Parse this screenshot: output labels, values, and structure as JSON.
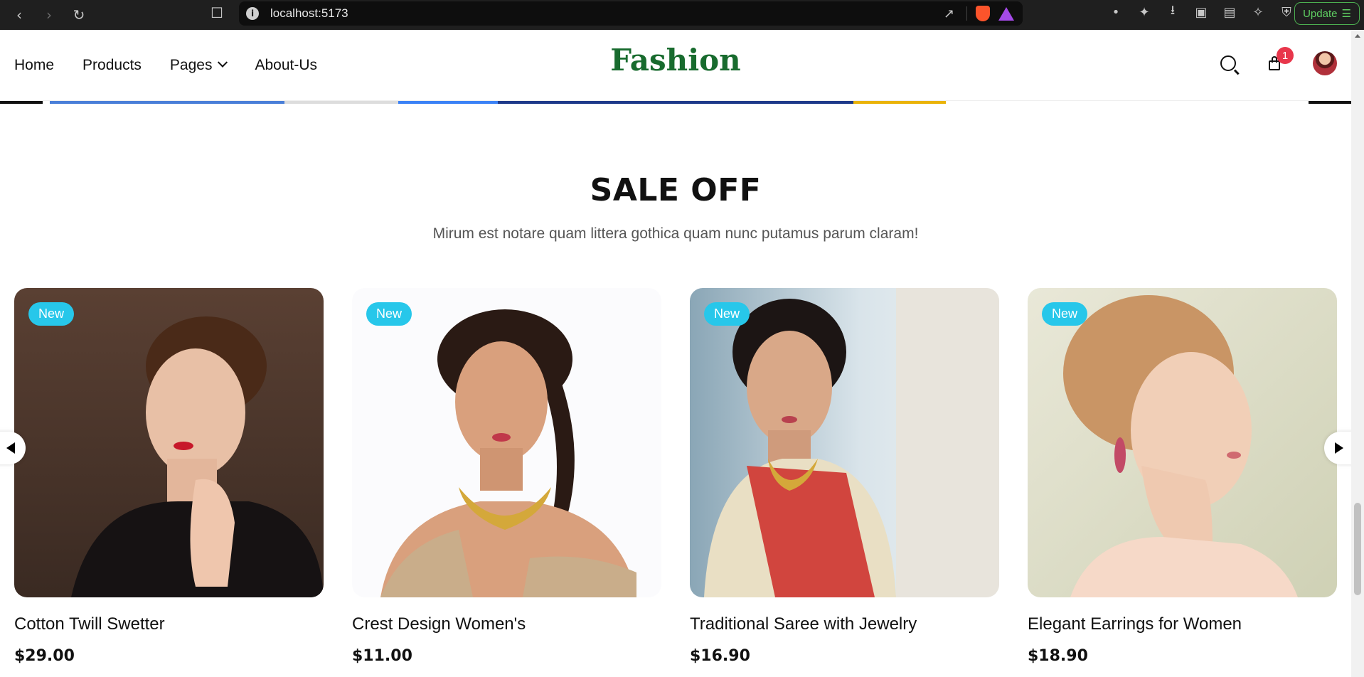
{
  "browser": {
    "url": "localhost:5173",
    "update_label": "Update"
  },
  "header": {
    "menu": [
      {
        "label": "Home"
      },
      {
        "label": "Products"
      },
      {
        "label": "Pages"
      },
      {
        "label": "About-Us"
      }
    ],
    "logo": "Fashion",
    "cart_count": "1"
  },
  "section": {
    "title": "SALE OFF",
    "subtitle": "Mirum est notare quam littera gothica quam nunc putamus parum claram!"
  },
  "products": [
    {
      "badge": "New",
      "name": "Cotton Twill Swetter",
      "price": "$29.00"
    },
    {
      "badge": "New",
      "name": "Crest Design Women's",
      "price": "$11.00"
    },
    {
      "badge": "New",
      "name": "Traditional Saree with Jewelry",
      "price": "$16.90"
    },
    {
      "badge": "New",
      "name": "Elegant Earrings for Women",
      "price": "$18.90"
    }
  ],
  "colors": {
    "brand": "#186b2e",
    "badge_new": "#27c7ea",
    "cart_badge": "#e8364b"
  }
}
